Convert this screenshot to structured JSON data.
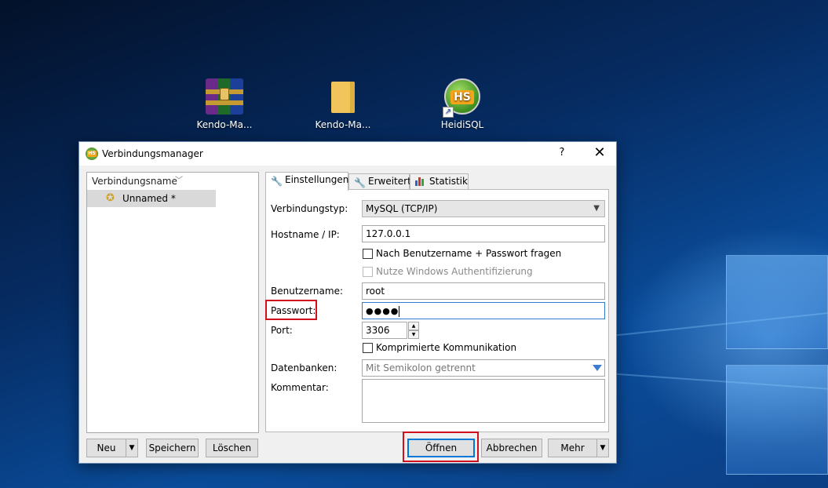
{
  "desktop": {
    "icons": [
      {
        "label": "Kendo-Ma...",
        "icon": "winrar-archive-icon"
      },
      {
        "label": "Kendo-Ma...",
        "icon": "folder-icon"
      },
      {
        "label": "HeidiSQL",
        "icon": "heidisql-icon"
      }
    ]
  },
  "dialog": {
    "title": "Verbindungsmanager",
    "help": "?",
    "close": "✕",
    "app_badge": "HS"
  },
  "sessions": {
    "header": "Verbindungsname",
    "items": [
      {
        "label": "Unnamed *"
      }
    ]
  },
  "tabs": [
    {
      "label": "Einstellungen",
      "active": true
    },
    {
      "label": "Erweitert",
      "active": false
    },
    {
      "label": "Statistik",
      "active": false
    }
  ],
  "settings": {
    "network_type_label": "Verbindungstyp:",
    "network_type_value": "MySQL (TCP/IP)",
    "hostname_label": "Hostname / IP:",
    "hostname_value": "127.0.0.1",
    "prompt_login_label": "Nach Benutzername + Passwort fragen",
    "windows_auth_label": "Nutze Windows Authentifizierung",
    "user_label": "Benutzername:",
    "user_value": "root",
    "password_label": "Passwort:",
    "password_value": "●●●●",
    "port_label": "Port:",
    "port_value": "3306",
    "compressed_label": "Komprimierte Kommunikation",
    "databases_label": "Datenbanken:",
    "databases_placeholder": "Mit Semikolon getrennt",
    "comment_label": "Kommentar:"
  },
  "buttons": {
    "new": "Neu",
    "save": "Speichern",
    "delete": "Löschen",
    "open": "Öffnen",
    "cancel": "Abbrechen",
    "more": "Mehr"
  },
  "colors": {
    "highlight": "#d0101c",
    "focus": "#0078d7"
  }
}
